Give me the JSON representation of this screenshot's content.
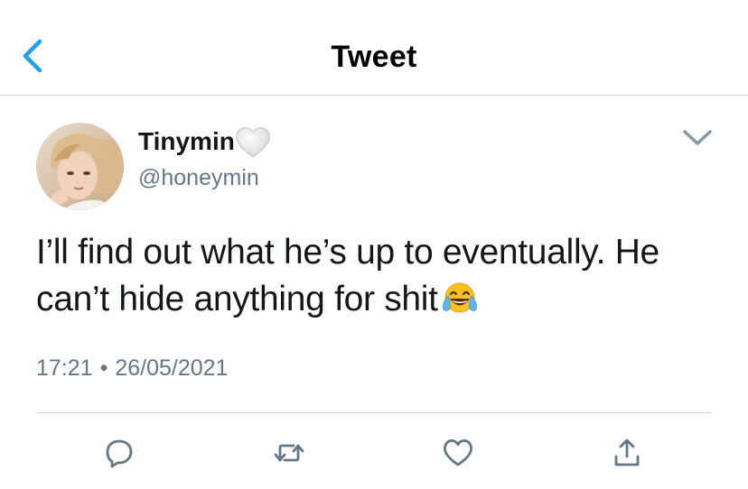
{
  "header": {
    "title": "Tweet",
    "back_icon": "chevron-left-icon"
  },
  "tweet": {
    "display_name": "Tinymin",
    "name_badge_icon": "white-heart-icon",
    "handle": "@honeymin",
    "text": "I’ll find out what he’s up to eventually. He can’t hide anything for shit",
    "text_emoji": "face-with-tears-of-joy-icon",
    "time": "17:21",
    "separator": "•",
    "date": "26/05/2021"
  },
  "actions": [
    "reply-icon",
    "retweet-icon",
    "like-icon",
    "share-icon"
  ],
  "colors": {
    "accent": "#1da1f2",
    "secondary_text": "#657786",
    "icon": "#657786",
    "divider": "#cfd3d6"
  }
}
